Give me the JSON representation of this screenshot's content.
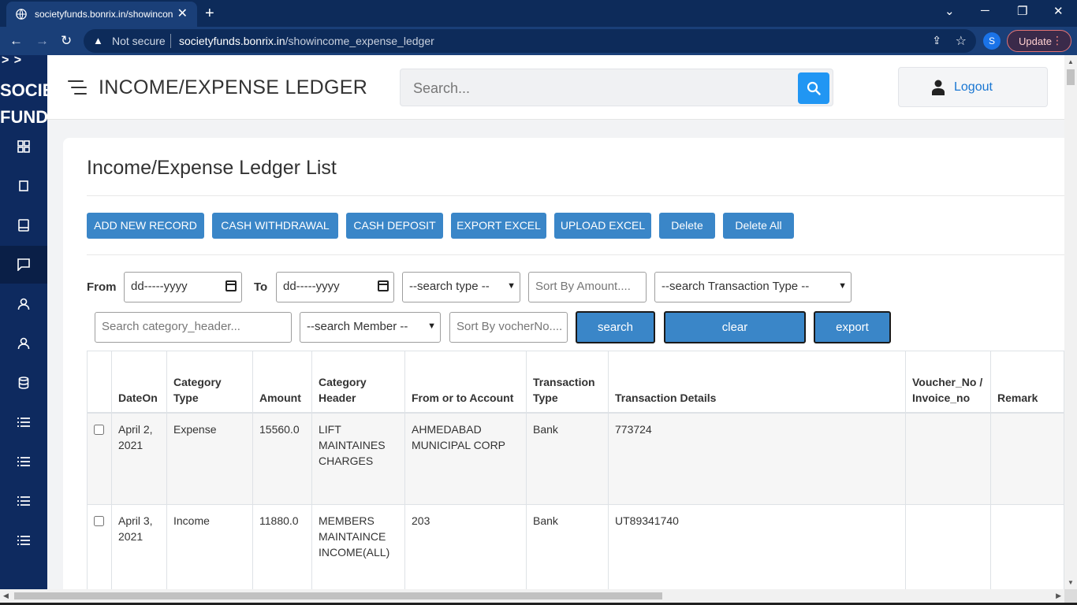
{
  "browser": {
    "tab_title": "societyfunds.bonrix.in/showincon",
    "url_security": "Not secure",
    "url_domain": "societyfunds.bonrix.in",
    "url_path": "/showincome_expense_ledger",
    "profile_initial": "S",
    "update_label": "Update"
  },
  "sidebar": {
    "toggle": "> >",
    "brand_line1": "SOCIETY",
    "brand_line2": "FUNDS",
    "icons": [
      "dashboard-icon",
      "page-icon",
      "book-icon",
      "chat-icon",
      "user-icon",
      "user-icon",
      "database-icon",
      "list-icon",
      "list-icon",
      "list-icon",
      "list-icon"
    ]
  },
  "header": {
    "title": "INCOME/EXPENSE LEDGER",
    "search_placeholder": "Search...",
    "logout_label": "Logout"
  },
  "card": {
    "title": "Income/Expense Ledger List",
    "actions": [
      "ADD NEW RECORD",
      "CASH WITHDRAWAL",
      "CASH DEPOSIT",
      "EXPORT EXCEL",
      "UPLOAD EXCEL",
      "Delete",
      "Delete All"
    ]
  },
  "filters": {
    "from_label": "From",
    "to_label": "To",
    "from_date": "dd-----yyyy",
    "to_date": "dd-----yyyy",
    "search_type": "--search type --",
    "amount_placeholder": "Sort By Amount....",
    "transaction_type": "--search Transaction Type --",
    "category_placeholder": "Search category_header...",
    "member": "--search Member --",
    "voucher_placeholder": "Sort By vocherNo....",
    "search_btn": "search",
    "clear_btn": "clear",
    "export_btn": "export"
  },
  "table": {
    "columns": [
      "",
      "DateOn",
      "Category Type",
      "Amount",
      "Category Header",
      "From or to Account",
      "Transaction Type",
      "Transaction Details",
      "Voucher_No / Invoice_no",
      "Remark"
    ],
    "rows": [
      {
        "date": "April 2, 2021",
        "category_type": "Expense",
        "amount": "15560.0",
        "category_header": "LIFT MAINTAINES CHARGES",
        "account": "AHMEDABAD MUNICIPAL CORP",
        "transaction_type": "Bank",
        "details": "773724",
        "voucher": "",
        "remark": ""
      },
      {
        "date": "April 3, 2021",
        "category_type": "Income",
        "amount": "11880.0",
        "category_header": "MEMBERS MAINTAINCE INCOME(ALL)",
        "account": "203",
        "transaction_type": "Bank",
        "details": "UT89341740",
        "voucher": "",
        "remark": ""
      }
    ]
  }
}
